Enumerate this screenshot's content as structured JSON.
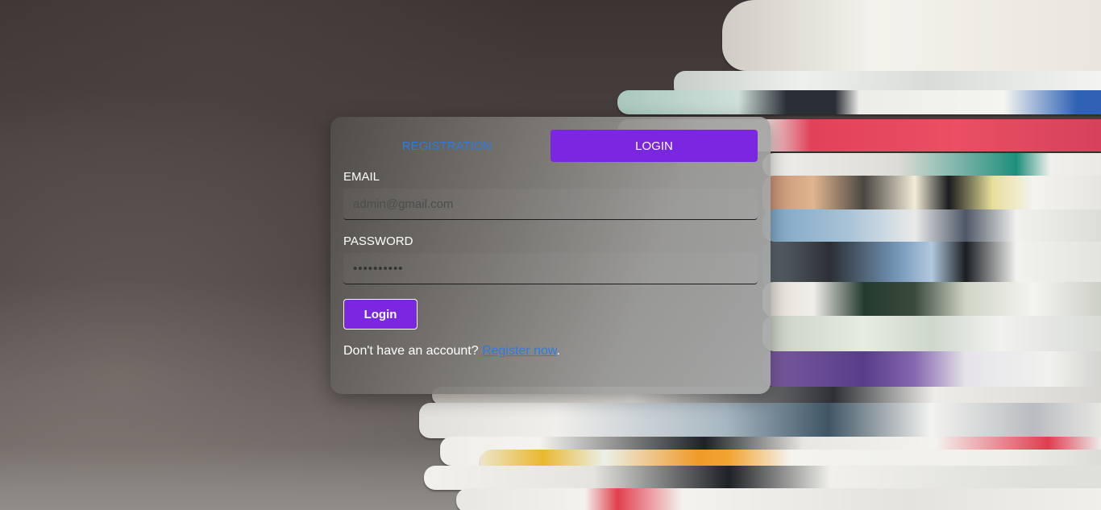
{
  "tabs": [
    {
      "label": "REGISTRATION",
      "active": false
    },
    {
      "label": "LOGIN",
      "active": true
    }
  ],
  "form": {
    "email_label": "EMAIL",
    "email_placeholder": "admin@gmail.com",
    "email_value": "",
    "password_label": "PASSWORD",
    "password_value": "••••••••••",
    "submit_label": "Login"
  },
  "register": {
    "prompt": "Don't have an account? ",
    "link_label": "Register now",
    "suffix": "."
  },
  "colors": {
    "accent": "#7b26e0",
    "link": "#2b7ce0"
  }
}
